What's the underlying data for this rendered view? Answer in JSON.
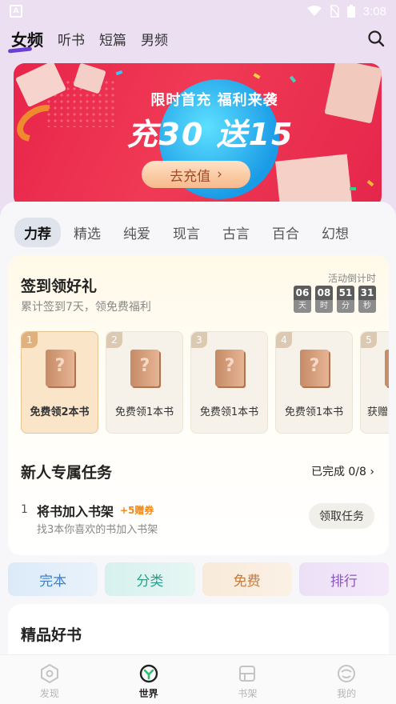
{
  "status_bar": {
    "time": "3:08"
  },
  "top_nav": {
    "tabs": [
      {
        "label": "女频",
        "active": true
      },
      {
        "label": "听书"
      },
      {
        "label": "短篇"
      },
      {
        "label": "男频"
      }
    ]
  },
  "banner": {
    "line1": "限时首充  福利来袭",
    "line2": "充30  送15",
    "button": "去充值"
  },
  "category_tabs": [
    "力荐",
    "精选",
    "纯爱",
    "现言",
    "古言",
    "百合",
    "幻想"
  ],
  "signin": {
    "title": "签到领好礼",
    "subtitle": "累计签到7天，领免费福利",
    "countdown_label": "活动倒计时",
    "countdown": [
      {
        "value": "06",
        "unit": "天"
      },
      {
        "value": "08",
        "unit": "时"
      },
      {
        "value": "51",
        "unit": "分"
      },
      {
        "value": "31",
        "unit": "秒"
      }
    ],
    "rewards": [
      {
        "num": "1",
        "label": "免费领2本书",
        "book_glyph": "?"
      },
      {
        "num": "2",
        "label": "免费领1本书",
        "book_glyph": "?"
      },
      {
        "num": "3",
        "label": "免费领1本书",
        "book_glyph": "?"
      },
      {
        "num": "4",
        "label": "免费领1本书",
        "book_glyph": "?"
      },
      {
        "num": "5",
        "label": "获赠",
        "book_glyph": "?"
      }
    ]
  },
  "tasks": {
    "title": "新人专属任务",
    "progress": "已完成 0/8",
    "item": {
      "index": "1",
      "name": "将书加入书架",
      "bonus": "+5赠券",
      "desc": "找3本你喜欢的书加入书架",
      "button": "领取任务"
    }
  },
  "quick_links": [
    "完本",
    "分类",
    "免费",
    "排行"
  ],
  "good_books": {
    "title": "精品好书"
  },
  "bottom_nav": [
    {
      "label": "发现",
      "icon": "discover-icon"
    },
    {
      "label": "世界",
      "icon": "world-icon",
      "active": true
    },
    {
      "label": "书架",
      "icon": "bookshelf-icon"
    },
    {
      "label": "我的",
      "icon": "profile-icon"
    }
  ],
  "colors": {
    "accent": "#6a3fd6",
    "banner_red": "#e8244a",
    "bonus_orange": "#f08a1c"
  }
}
